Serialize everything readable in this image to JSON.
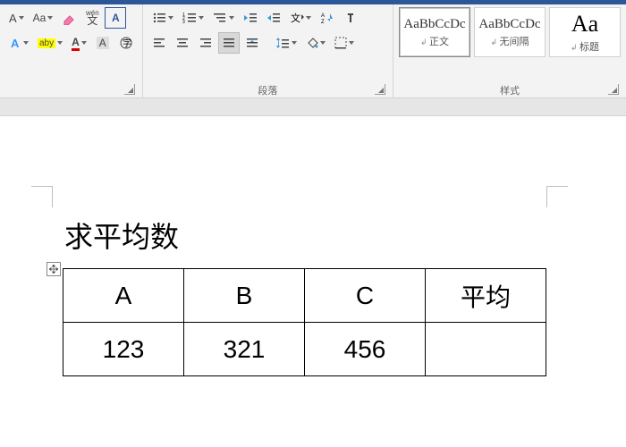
{
  "ribbon": {
    "font": {
      "change_case": "Aa",
      "grow": "A",
      "pinyin": "wén",
      "border": "A",
      "highlight": "aby",
      "font_color": "A",
      "shading": "A",
      "label": ""
    },
    "paragraph": {
      "label": "段落"
    },
    "styles": {
      "label": "样式",
      "items": [
        {
          "sample": "AaBbCcDc",
          "name": "正文",
          "selected": true,
          "big": false
        },
        {
          "sample": "AaBbCcDc",
          "name": "无间隔",
          "selected": false,
          "big": false
        },
        {
          "sample": "Aa",
          "name": "标题",
          "selected": false,
          "big": true
        }
      ]
    }
  },
  "document": {
    "heading": "求平均数",
    "table": {
      "headers": [
        "A",
        "B",
        "C",
        "平均"
      ],
      "rows": [
        [
          "123",
          "321",
          "456",
          ""
        ]
      ]
    }
  }
}
